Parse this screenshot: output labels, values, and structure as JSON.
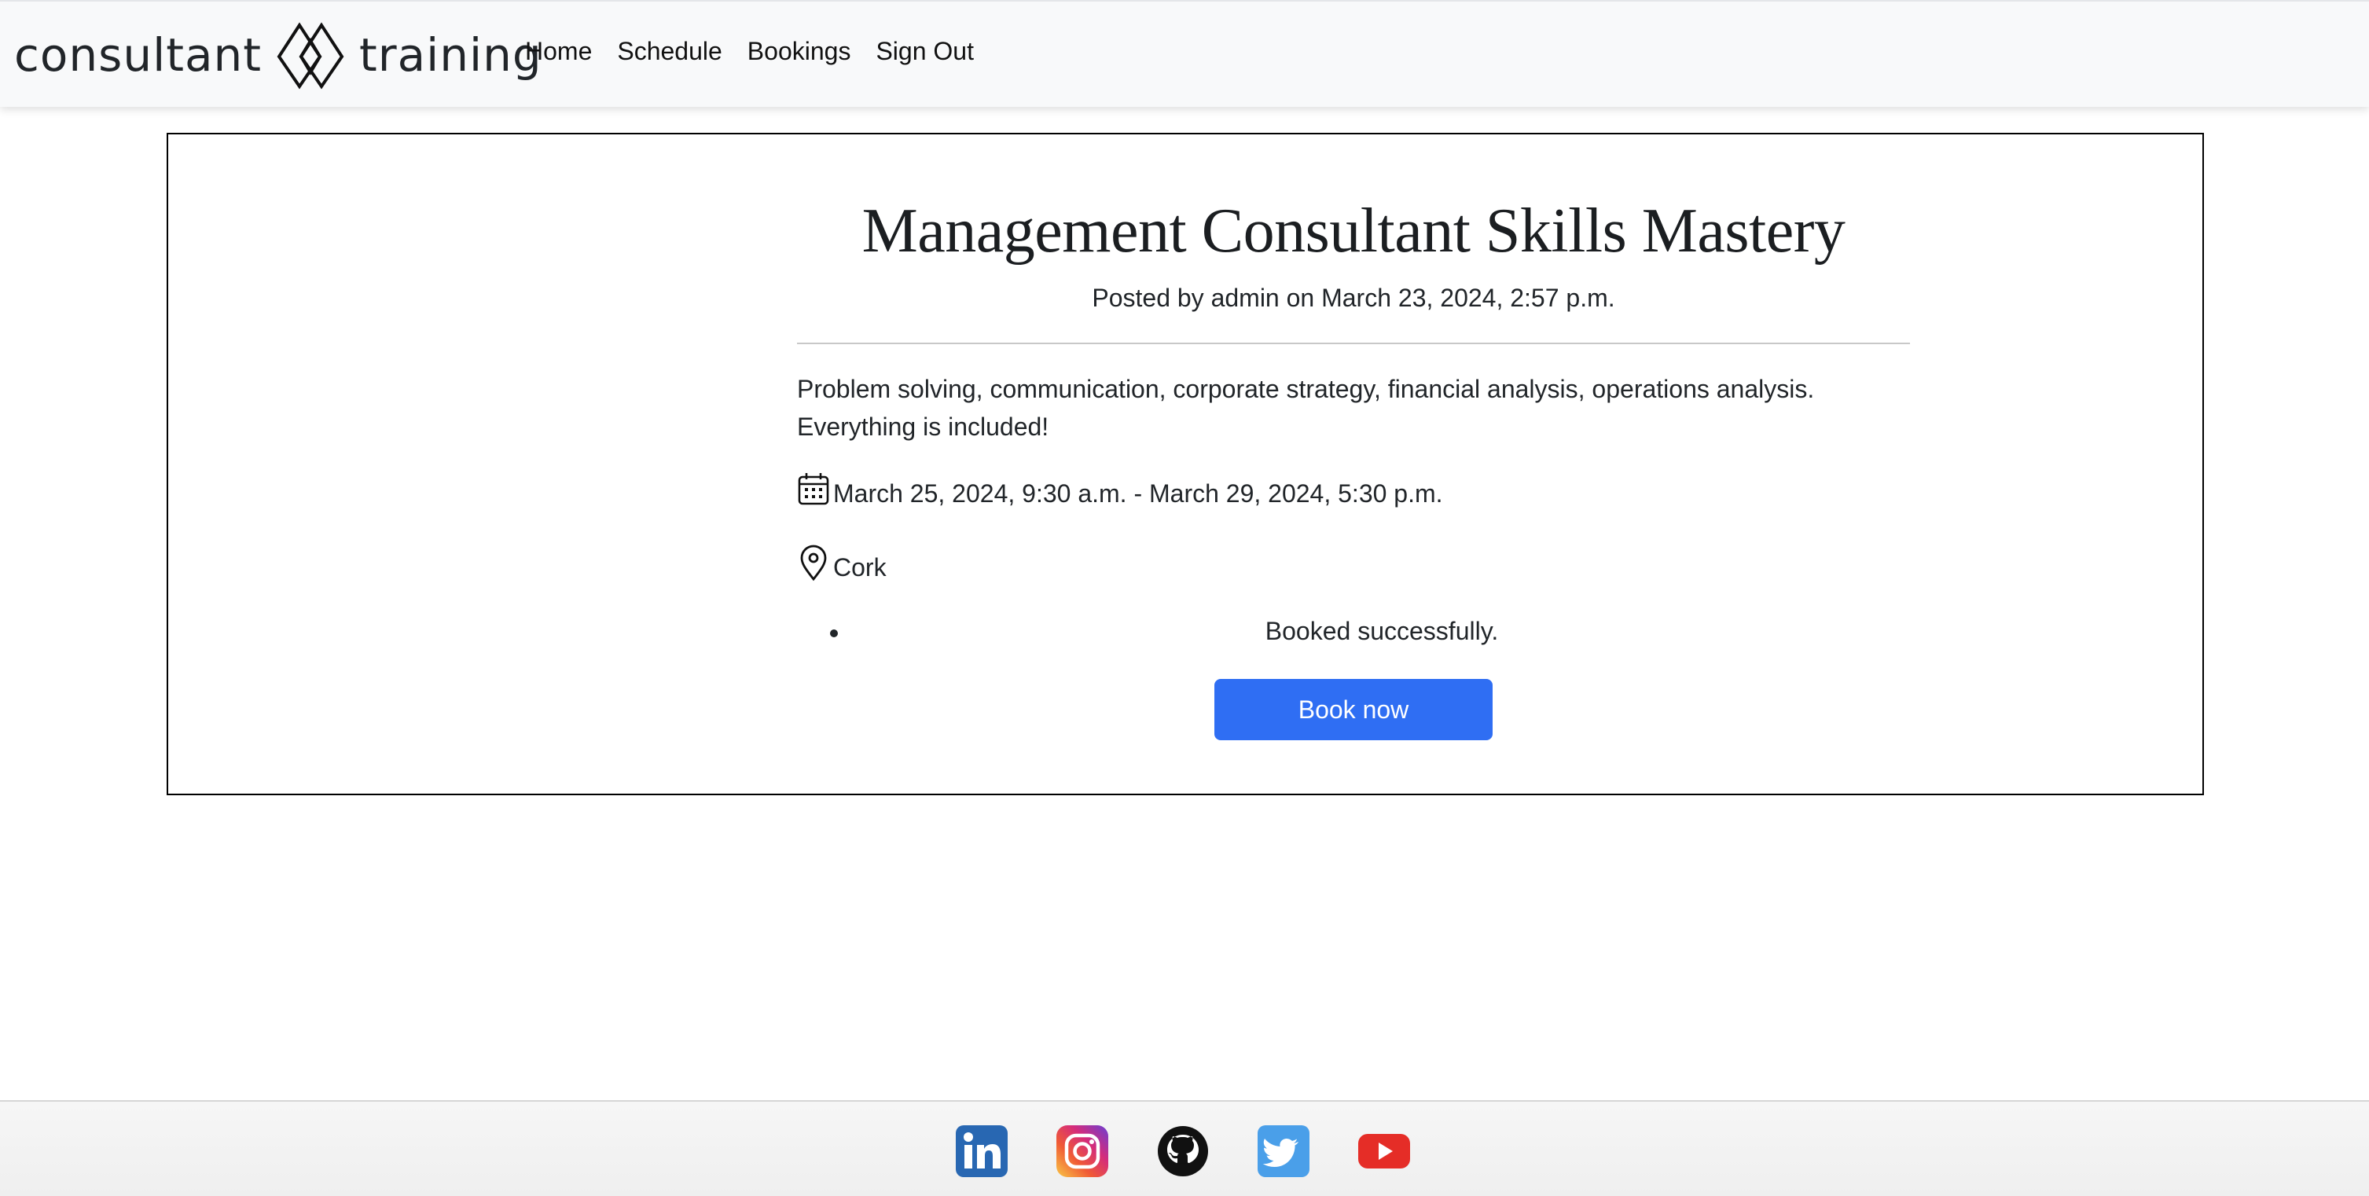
{
  "brand": {
    "left_word": "consultant",
    "right_word": "training",
    "logo_icon": "double-diamond-logo"
  },
  "nav": {
    "items": [
      {
        "label": "Home"
      },
      {
        "label": "Schedule"
      },
      {
        "label": "Bookings"
      },
      {
        "label": "Sign Out"
      }
    ]
  },
  "post": {
    "title": "Management Consultant Skills Mastery",
    "byline": "Posted by admin on March 23, 2024, 2:57 p.m.",
    "description_lines": [
      "Problem solving, communication, corporate strategy, financial analysis, operations analysis.",
      "Everything is included!"
    ],
    "date_range": "March 25, 2024, 9:30 a.m. - March 29, 2024, 5:30 p.m.",
    "location": "Cork",
    "date_icon": "calendar-icon",
    "location_icon": "map-pin-icon"
  },
  "messages": [
    "Booked successfully."
  ],
  "book_button": {
    "label": "Book now"
  },
  "footer": {
    "socials": [
      {
        "icon": "linkedin-icon"
      },
      {
        "icon": "instagram-icon"
      },
      {
        "icon": "github-icon"
      },
      {
        "icon": "twitter-icon"
      },
      {
        "icon": "youtube-icon"
      }
    ]
  },
  "colors": {
    "accent": "#2f6ef3",
    "navbar_bg": "#f8f9fa",
    "text": "#212529"
  }
}
